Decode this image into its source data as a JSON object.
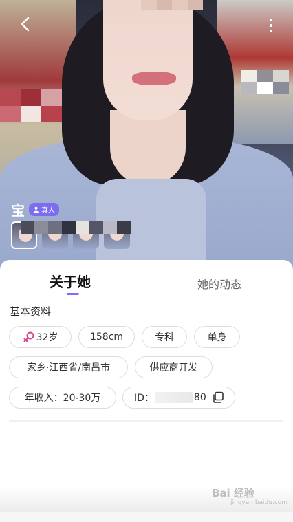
{
  "profile": {
    "name": "宝",
    "verify_badge": "真人",
    "photo_count": 4
  },
  "tabs": {
    "about": "关于她",
    "moments": "她的动态"
  },
  "basic_info": {
    "title": "基本资料",
    "age": "32岁",
    "height": "158cm",
    "education": "专科",
    "marital_status": "单身",
    "hometown": "家乡·江西省/南昌市",
    "job": "供应商开发",
    "income": "年收入：20-30万",
    "id_prefix": "ID：",
    "id_suffix": "80"
  },
  "watermark": {
    "text": "Bai 经验",
    "sub": "jingyan.baidu.com"
  },
  "colors": {
    "accent": "#7a6df0",
    "female_icon": "#e0418e",
    "tab_underline_start": "#5a78ff",
    "tab_underline_end": "#a560ff"
  },
  "icons": {
    "back": "chevron-left-icon",
    "more": "more-vertical-icon",
    "verify": "person-icon",
    "gender": "female-icon",
    "copy": "copy-icon"
  }
}
